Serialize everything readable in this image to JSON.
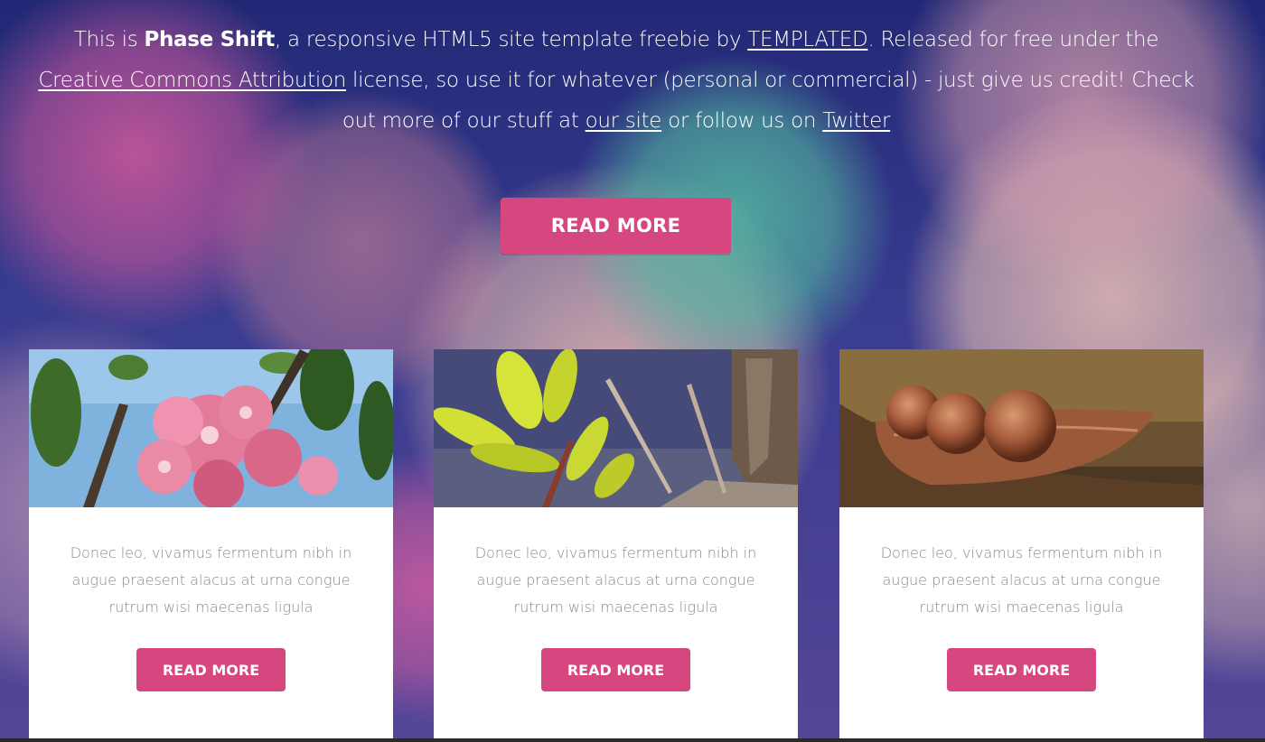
{
  "intro": {
    "p1": "This is ",
    "brand": "Phase Shift",
    "p2": ", a responsive HTML5 site template freebie by ",
    "link_templated": "TEMPLATED",
    "p3": ". Released for free under the ",
    "link_cc": "Creative Commons Attribution",
    "p4": " license, so use it for whatever (personal or commercial) - just give us credit! Check out more of our stuff at ",
    "link_site": "our site",
    "p5": " or follow us on ",
    "link_twitter": "Twitter"
  },
  "hero_button": "READ MORE",
  "cards": [
    {
      "text": "Donec leo, vivamus fermentum nibh in augue praesent alacus at urna congue rutrum wisi maecenas ligula",
      "button": "READ MORE"
    },
    {
      "text": "Donec leo, vivamus fermentum nibh in augue praesent alacus at urna congue rutrum wisi maecenas ligula",
      "button": "READ MORE"
    },
    {
      "text": "Donec leo, vivamus fermentum nibh in augue praesent alacus at urna congue rutrum wisi maecenas ligula",
      "button": "READ MORE"
    }
  ],
  "colors": {
    "accent": "#d6477f",
    "card_text": "#888888",
    "background": "#3a3f9a"
  }
}
